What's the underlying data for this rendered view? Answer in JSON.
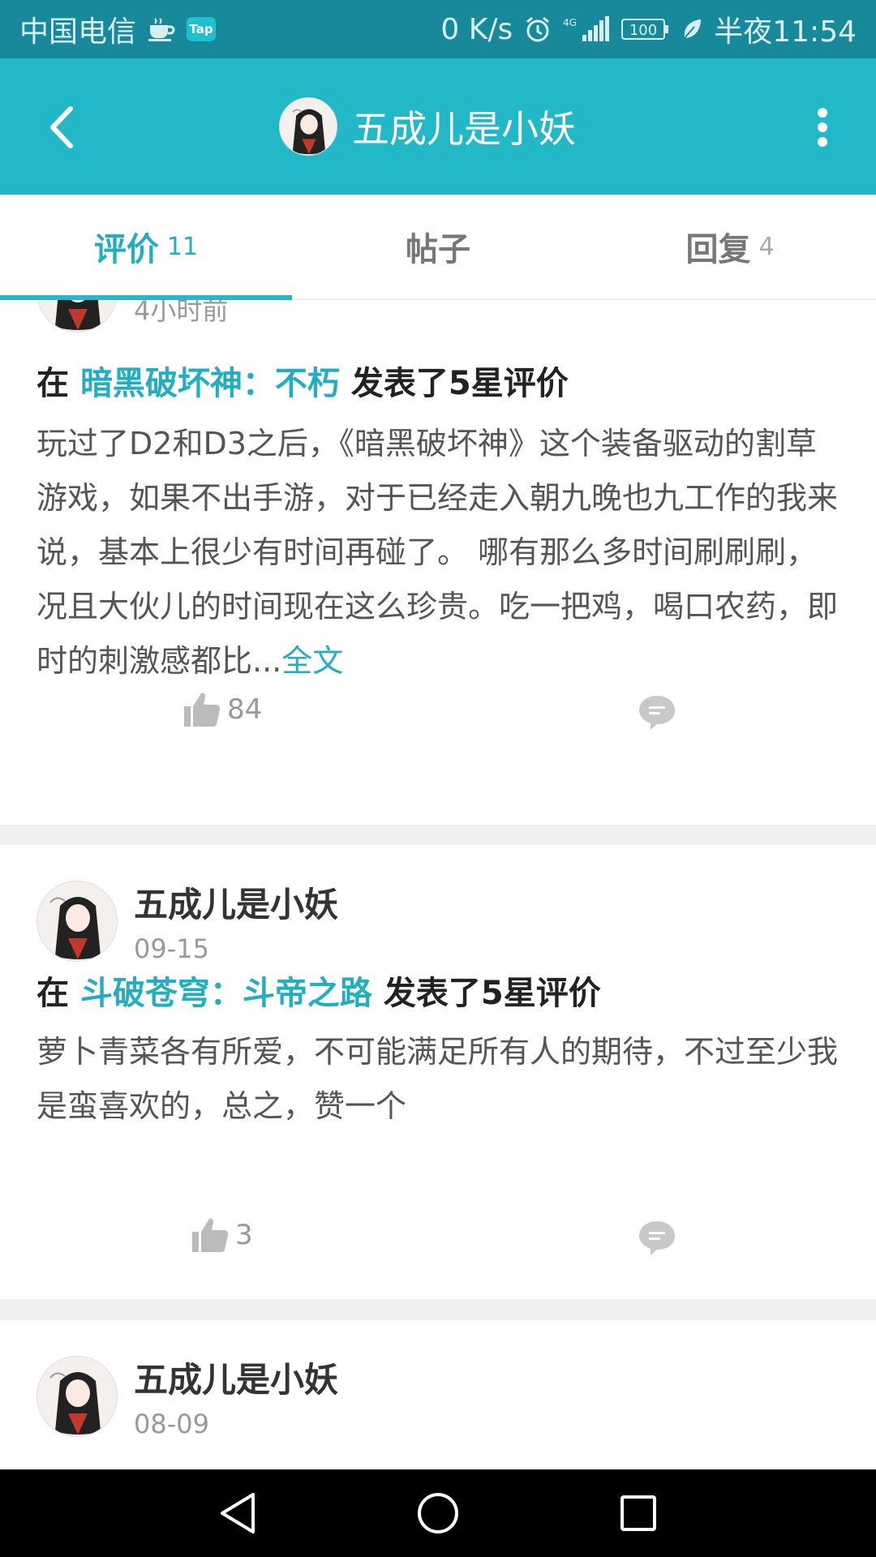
{
  "status_bar": {
    "carrier": "中国电信",
    "tap_badge": "Tap",
    "net_speed": "0 K/s",
    "network": "4G",
    "battery": "100",
    "time": "半夜11:54"
  },
  "header": {
    "title": "五成儿是小妖"
  },
  "tabs": [
    {
      "label": "评价",
      "count": "11"
    },
    {
      "label": "帖子",
      "count": ""
    },
    {
      "label": "回复",
      "count": "4"
    }
  ],
  "reviews": [
    {
      "date": "4小时前",
      "prefix": "在",
      "game": "暗黑破坏神：不朽",
      "suffix": "发表了5星评价",
      "text": "玩过了D2和D3之后，《暗黑破坏神》这个装备驱动的割草游戏，如果不出手游，对于已经走入朝九晚也九工作的我来说，基本上很少有时间再碰了。 哪有那么多时间刷刷刷，况且大伙儿的时间现在这么珍贵。吃一把鸡，喝口农药，即时的刺激感都比...",
      "more": "全文",
      "likes": "84"
    },
    {
      "user": "五成儿是小妖",
      "date": "09-15",
      "prefix": "在",
      "game": "斗破苍穹：斗帝之路",
      "suffix": "发表了5星评价",
      "text": "萝卜青菜各有所爱，不可能满足所有人的期待，不过至少我是蛮喜欢的，总之，赞一个",
      "likes": "3"
    },
    {
      "user": "五成儿是小妖",
      "date": "08-09"
    }
  ],
  "colors": {
    "accent": "#22b8c8",
    "status_bar": "#17899a",
    "link": "#22aebf"
  }
}
